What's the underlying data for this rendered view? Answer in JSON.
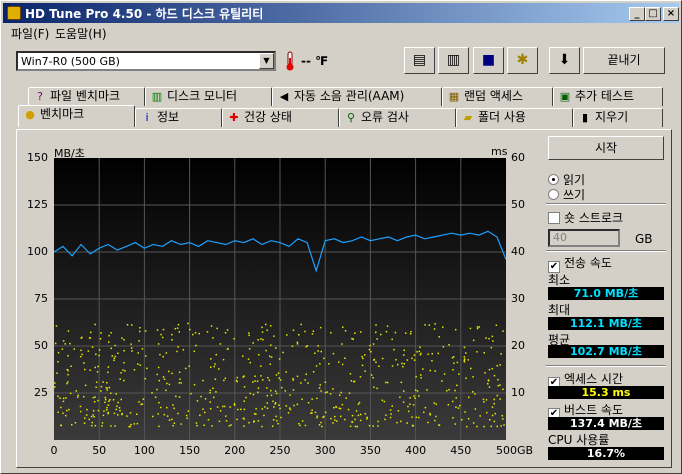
{
  "window": {
    "title": "HD Tune Pro 4.50 - 하드 디스크 유틸리티"
  },
  "menu": [
    "파일(F)",
    "도움말(H)"
  ],
  "toolbar": {
    "drive": "Win7-R0  (500 GB)",
    "temperature": "-- ℉",
    "exit_label": "끝내기"
  },
  "tabs_row1": [
    {
      "label": "파일 벤치마크",
      "icon": "file-benchmark-icon"
    },
    {
      "label": "디스크 모니터",
      "icon": "disk-monitor-icon"
    },
    {
      "label": "자동 소음 관리(AAM)",
      "icon": "speaker-icon"
    },
    {
      "label": "랜덤 액세스",
      "icon": "random-access-icon"
    },
    {
      "label": "추가 테스트",
      "icon": "extra-tests-icon"
    }
  ],
  "tabs_row2": [
    {
      "label": "벤치마크",
      "icon": "benchmark-icon"
    },
    {
      "label": "정보",
      "icon": "info-icon"
    },
    {
      "label": "건강 상태",
      "icon": "health-cross-icon"
    },
    {
      "label": "오류 검사",
      "icon": "magnifier-icon"
    },
    {
      "label": "폴더 사용",
      "icon": "folder-icon"
    },
    {
      "label": "지우기",
      "icon": "trash-icon"
    }
  ],
  "side": {
    "start_label": "시작",
    "read_label": "읽기",
    "write_label": "쓰기",
    "short_stroke_label": "숏 스트로크",
    "short_stroke_value": "40",
    "gb_label": "GB",
    "transfer_rate_label": "전송 속도",
    "min_label": "최소",
    "min_value": "71.0 MB/초",
    "max_label": "최대",
    "max_value": "112.1 MB/초",
    "avg_label": "평균",
    "avg_value": "102.7 MB/초",
    "access_time_label": "엑세스 시간",
    "access_time_value": "15.3 ms",
    "burst_rate_label": "버스트 속도",
    "burst_rate_value": "137.4 MB/초",
    "cpu_label": "CPU 사용률",
    "cpu_value": "16.7%"
  },
  "colors": {
    "transfer_line": "#1ea0ff",
    "access_dots": "#e8e800",
    "stat_text": "#00e0ff",
    "access_text": "#ffff00"
  },
  "chart_data": {
    "type": "line",
    "ylabel_left": "MB/초",
    "ylabel_right": "ms",
    "left_ticks": [
      "150",
      "125",
      "100",
      "75",
      "50",
      "25"
    ],
    "right_ticks": [
      "60",
      "50",
      "40",
      "30",
      "20",
      "10"
    ],
    "x_ticks": [
      "0",
      "50",
      "100",
      "150",
      "200",
      "250",
      "300",
      "350",
      "400",
      "450",
      "500GB"
    ],
    "xlim": [
      0,
      500
    ],
    "ylim_left": [
      0,
      150
    ],
    "ylim_right": [
      0,
      60
    ],
    "grid": true,
    "series": [
      {
        "axis": "left",
        "x": [
          0,
          10,
          20,
          30,
          40,
          50,
          60,
          70,
          80,
          90,
          100,
          110,
          120,
          130,
          140,
          150,
          160,
          170,
          180,
          190,
          200,
          210,
          220,
          230,
          240,
          250,
          260,
          270,
          280,
          290,
          300,
          310,
          320,
          330,
          340,
          350,
          360,
          370,
          380,
          390,
          400,
          410,
          420,
          430,
          440,
          450,
          460,
          470,
          480,
          490,
          500
        ],
        "values": [
          100,
          103,
          98,
          104,
          99,
          102,
          104,
          101,
          103,
          105,
          102,
          104,
          103,
          106,
          104,
          105,
          103,
          106,
          105,
          104,
          106,
          105,
          107,
          104,
          106,
          105,
          103,
          107,
          105,
          90,
          106,
          107,
          105,
          106,
          108,
          106,
          107,
          108,
          106,
          108,
          109,
          107,
          108,
          109,
          110,
          109,
          110,
          109,
          111,
          108,
          96
        ]
      }
    ],
    "access_time": {
      "axis": "right",
      "x_range": [
        0,
        500
      ],
      "min": 3,
      "max": 25
    }
  }
}
